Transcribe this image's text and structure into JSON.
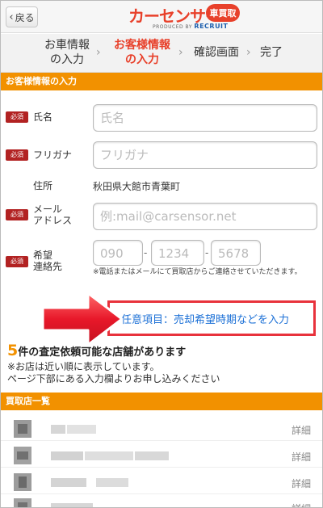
{
  "header": {
    "back_label": "戻る",
    "logo_text": "カーセンサー",
    "logo_badge": "車買取",
    "logo_produced": "PRODUCED BY",
    "logo_recruit": "RECRUIT"
  },
  "steps": [
    {
      "line1": "お車情報",
      "line2": "の入力",
      "active": false
    },
    {
      "line1": "お客様情報",
      "line2": "の入力",
      "active": true
    },
    {
      "line1": "確認画面",
      "line2": "",
      "active": false
    },
    {
      "line1": "完了",
      "line2": "",
      "active": false
    }
  ],
  "customer_section": {
    "title": "お客様情報の入力"
  },
  "form": {
    "required_badge": "必須",
    "name": {
      "label": "氏名",
      "placeholder": "氏名"
    },
    "furigana": {
      "label": "フリガナ",
      "placeholder": "フリガナ"
    },
    "address": {
      "label": "住所",
      "value": "秋田県大館市青葉町"
    },
    "email": {
      "label_line1": "メール",
      "label_line2": "アドレス",
      "placeholder": "例:mail@carsensor.net"
    },
    "phone": {
      "label_line1": "希望",
      "label_line2": "連絡先",
      "part1": "090",
      "part2": "1234",
      "part3": "5678",
      "separator": "-",
      "note": "※電話またはメールにて買取店からご連絡させていただきます。"
    }
  },
  "optional": {
    "link_text": "任意項目：売却希望時期などを入力"
  },
  "shops_info": {
    "count": "5",
    "count_text": "件の査定依頼可能な店舗があります",
    "note1": "※お店は近い順に表示しています。",
    "note2": "ページ下部にある入力欄よりお申し込みください"
  },
  "shop_list": {
    "title": "買取店一覧",
    "detail_label": "詳細",
    "rows": 4
  },
  "colors": {
    "accent": "#f29100",
    "brand": "#e8402a",
    "required": "#b22222",
    "link": "#1a6fd6",
    "highlight": "#e8323c"
  }
}
